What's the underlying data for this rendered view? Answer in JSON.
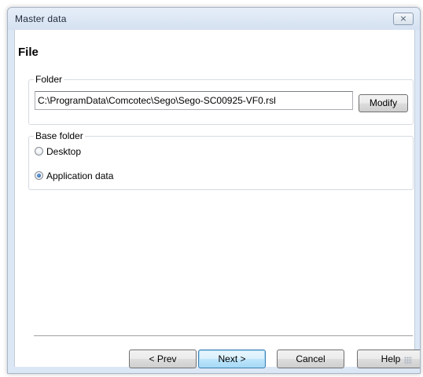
{
  "window": {
    "title": "Master data",
    "close_icon": "×"
  },
  "page": {
    "title": "File"
  },
  "folder_group": {
    "label": "Folder",
    "path_value": "C:\\ProgramData\\Comcotec\\Sego\\Sego-SC00925-VF0.rsl",
    "modify_label": "Modify"
  },
  "base_folder_group": {
    "label": "Base folder",
    "options": [
      {
        "label": "Desktop",
        "selected": false
      },
      {
        "label": "Application data",
        "selected": true
      }
    ]
  },
  "buttons": {
    "prev_label": "< Prev",
    "next_label": "Next >",
    "cancel_label": "Cancel",
    "help_label": "Help"
  }
}
